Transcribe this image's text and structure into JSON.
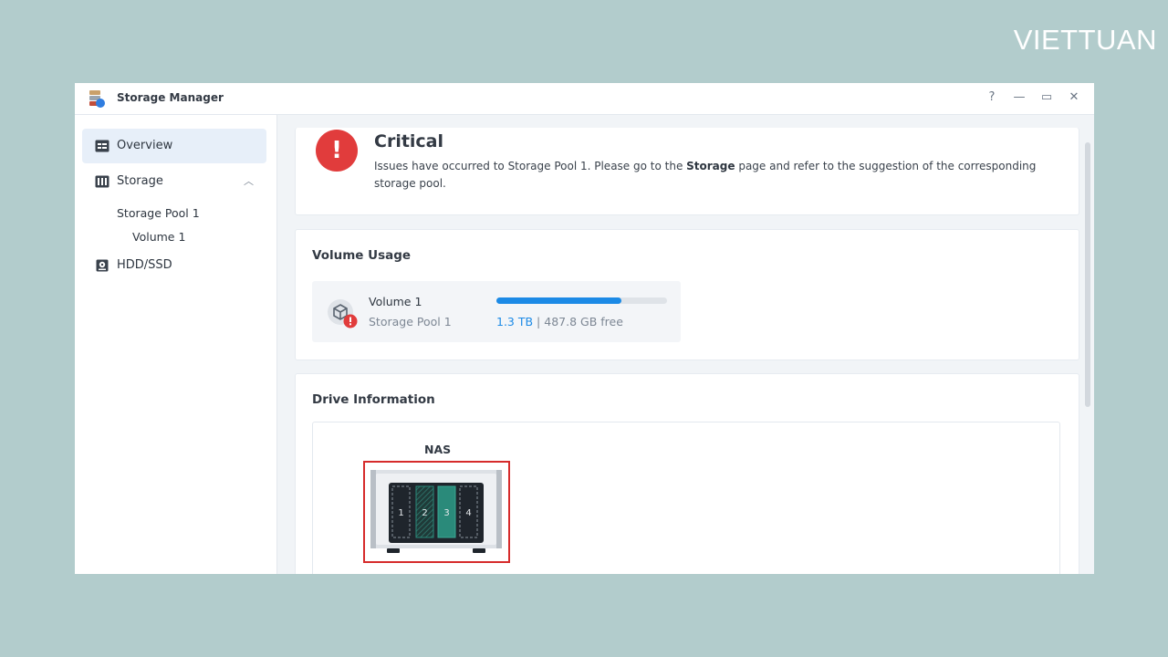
{
  "brand": {
    "logo_text": "VIETTUAN"
  },
  "window": {
    "title": "Storage Manager",
    "controls": {
      "help": "?",
      "minimize": "—",
      "maximize": "▭",
      "close": "✕"
    }
  },
  "sidebar": {
    "overview": "Overview",
    "storage": "Storage",
    "storage_pool": "Storage Pool 1",
    "volume": "Volume 1",
    "hdd": "HDD/SSD"
  },
  "critical": {
    "icon": "!",
    "title": "Critical",
    "message_pre": "Issues have occurred to Storage Pool 1. Please go to the ",
    "message_bold": "Storage",
    "message_post": " page and refer to the suggestion of the corresponding storage pool."
  },
  "volume_usage": {
    "title": "Volume Usage",
    "volume_name": "Volume 1",
    "pool_name": "Storage Pool 1",
    "used": "1.3 TB",
    "separator": " | ",
    "free": "487.8 GB free",
    "usage_fraction": 0.73
  },
  "drive_info": {
    "title": "Drive Information",
    "device_label": "NAS",
    "bays": [
      "1",
      "2",
      "3",
      "4"
    ]
  },
  "colors": {
    "accent": "#1c8ae6",
    "critical": "#e13c3c",
    "drive_teal": "#2a8a7a",
    "highlight": "#d62b2b"
  }
}
